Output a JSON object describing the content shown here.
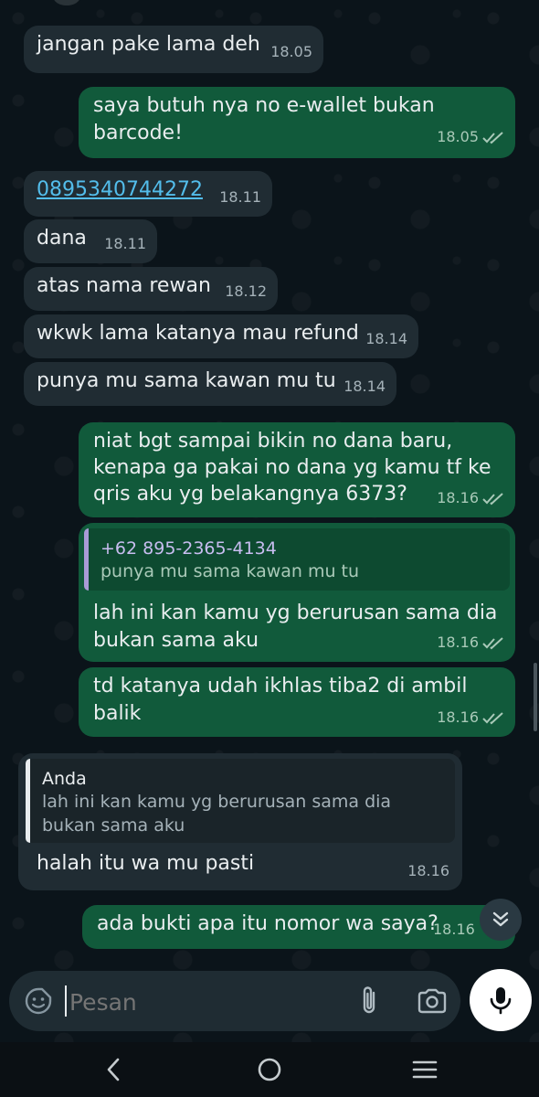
{
  "messages": [
    {
      "dir": "in",
      "text": "jangan pake lama deh",
      "time": "18.05"
    },
    {
      "dir": "out",
      "text": "saya butuh nya no e-wallet bukan\nbarcode!",
      "time": "18.05"
    },
    {
      "dir": "in",
      "text": "0895340744272",
      "time": "18.11"
    },
    {
      "dir": "in",
      "text": "dana",
      "time": "18.11"
    },
    {
      "dir": "in",
      "text": "atas nama rewan",
      "time": "18.12"
    },
    {
      "dir": "in",
      "text": "wkwk lama katanya mau refund",
      "time": "18.14"
    },
    {
      "dir": "in",
      "text": "punya mu sama kawan mu tu",
      "time": "18.14"
    },
    {
      "dir": "out",
      "text": "niat bgt sampai bikin no dana baru,\nkenapa ga pakai no dana yg kamu tf ke\nqris aku yg belakangnya 6373?",
      "time": "18.16"
    },
    {
      "dir": "out",
      "quote": {
        "name": "+62 895-2365-4134",
        "text": "punya mu sama kawan mu tu"
      },
      "text": "lah ini kan kamu yg berurusan sama dia\nbukan sama aku",
      "time": "18.16"
    },
    {
      "dir": "out",
      "text": "td katanya udah ikhlas tiba2 di ambil\nbalik",
      "time": "18.16"
    },
    {
      "dir": "in",
      "quote": {
        "name": "Anda",
        "text": "lah ini kan kamu yg berurusan sama dia\nbukan sama aku"
      },
      "text": "halah itu wa mu pasti",
      "time": "18.16"
    },
    {
      "dir": "out",
      "text": "ada bukti apa itu nomor wa saya?",
      "time": "18.16"
    }
  ],
  "input": {
    "placeholder": "Pesan"
  },
  "icons": {
    "emoji": "sticker-smile-icon",
    "attach": "paperclip-icon",
    "camera": "camera-icon",
    "mic": "microphone-icon",
    "scroll": "double-chevron-down-icon",
    "read": "double-check-icon",
    "back": "chevron-left-icon",
    "home": "circle-home-icon",
    "recents": "three-lines-icon"
  },
  "colors": {
    "incoming": "#202c33",
    "outgoing": "#115a3b",
    "link": "#53bdeb",
    "background": "#0b141a"
  }
}
